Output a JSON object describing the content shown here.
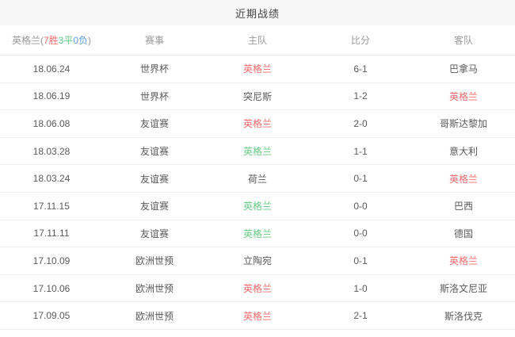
{
  "title": "近期战绩",
  "colors": {
    "win": "#f86c6c",
    "draw": "#67cb85",
    "loss": "#5b9ce6",
    "header_text": "#999999",
    "cell_text": "#5a5a5a",
    "title_bar_bg": "#f6f6f6"
  },
  "header": {
    "team_name": "英格兰",
    "record_open": "(",
    "wins": "7胜",
    "draws": "3平",
    "losses": "0负",
    "record_close": ")",
    "columns": [
      "赛事",
      "主队",
      "比分",
      "客队"
    ]
  },
  "rows": [
    {
      "date": "18.06.24",
      "competition": "世界杯",
      "home": "英格兰",
      "home_result": "win",
      "score": "6-1",
      "away": "巴拿马",
      "away_result": ""
    },
    {
      "date": "18.06.19",
      "competition": "世界杯",
      "home": "突尼斯",
      "home_result": "",
      "score": "1-2",
      "away": "英格兰",
      "away_result": "win"
    },
    {
      "date": "18.06.08",
      "competition": "友谊赛",
      "home": "英格兰",
      "home_result": "win",
      "score": "2-0",
      "away": "哥斯达黎加",
      "away_result": ""
    },
    {
      "date": "18.03.28",
      "competition": "友谊赛",
      "home": "英格兰",
      "home_result": "draw",
      "score": "1-1",
      "away": "意大利",
      "away_result": ""
    },
    {
      "date": "18.03.24",
      "competition": "友谊赛",
      "home": "荷兰",
      "home_result": "",
      "score": "0-1",
      "away": "英格兰",
      "away_result": "win"
    },
    {
      "date": "17.11.15",
      "competition": "友谊赛",
      "home": "英格兰",
      "home_result": "draw",
      "score": "0-0",
      "away": "巴西",
      "away_result": ""
    },
    {
      "date": "17.11.11",
      "competition": "友谊赛",
      "home": "英格兰",
      "home_result": "draw",
      "score": "0-0",
      "away": "德国",
      "away_result": ""
    },
    {
      "date": "17.10.09",
      "competition": "欧洲世预",
      "home": "立陶宛",
      "home_result": "",
      "score": "0-1",
      "away": "英格兰",
      "away_result": "win"
    },
    {
      "date": "17.10.06",
      "competition": "欧洲世预",
      "home": "英格兰",
      "home_result": "win",
      "score": "1-0",
      "away": "斯洛文尼亚",
      "away_result": ""
    },
    {
      "date": "17.09.05",
      "competition": "欧洲世预",
      "home": "英格兰",
      "home_result": "win",
      "score": "2-1",
      "away": "斯洛伐克",
      "away_result": ""
    }
  ]
}
